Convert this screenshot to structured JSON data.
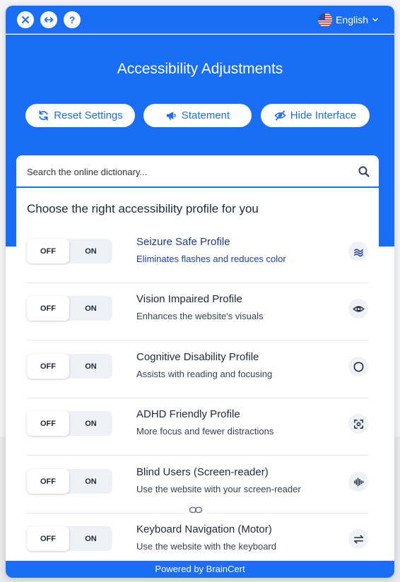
{
  "header": {
    "close_icon": "close-icon",
    "swap_icon": "swap-horizontal-icon",
    "help_label": "?",
    "language": "English",
    "flag_icon": "us-flag-icon"
  },
  "title": "Accessibility Adjustments",
  "actions": {
    "reset_label": "Reset Settings",
    "statement_label": "Statement",
    "hide_label": "Hide Interface"
  },
  "search": {
    "placeholder": "Search the online dictionary..."
  },
  "profiles_heading": "Choose the right accessibility profile for you",
  "profiles": [
    {
      "title": "Seizure Safe Profile",
      "desc": "Eliminates flashes and reduces color",
      "off_label": "OFF",
      "on_label": "ON",
      "icon": "waves-icon"
    },
    {
      "title": "Vision Impaired Profile",
      "desc": "Enhances the website's visuals",
      "off_label": "OFF",
      "on_label": "ON",
      "icon": "eye-icon"
    },
    {
      "title": "Cognitive Disability Profile",
      "desc": "Assists with reading and focusing",
      "off_label": "OFF",
      "on_label": "ON",
      "icon": "brain-icon"
    },
    {
      "title": "ADHD Friendly Profile",
      "desc": "More focus and fewer distractions",
      "off_label": "OFF",
      "on_label": "ON",
      "icon": "focus-target-icon"
    },
    {
      "title": "Blind Users (Screen-reader)",
      "desc": "Use the website with your screen-reader",
      "off_label": "OFF",
      "on_label": "ON",
      "icon": "audio-waveform-icon"
    },
    {
      "title": "Keyboard Navigation (Motor)",
      "desc": "Use the website with the keyboard",
      "off_label": "OFF",
      "on_label": "ON",
      "icon": "arrows-swap-icon"
    }
  ],
  "footer": "Powered by BrainCert",
  "colors": {
    "accent": "#1a6ef5",
    "toggle_bg": "#eef2f7",
    "active_text": "#1e3a8a"
  }
}
